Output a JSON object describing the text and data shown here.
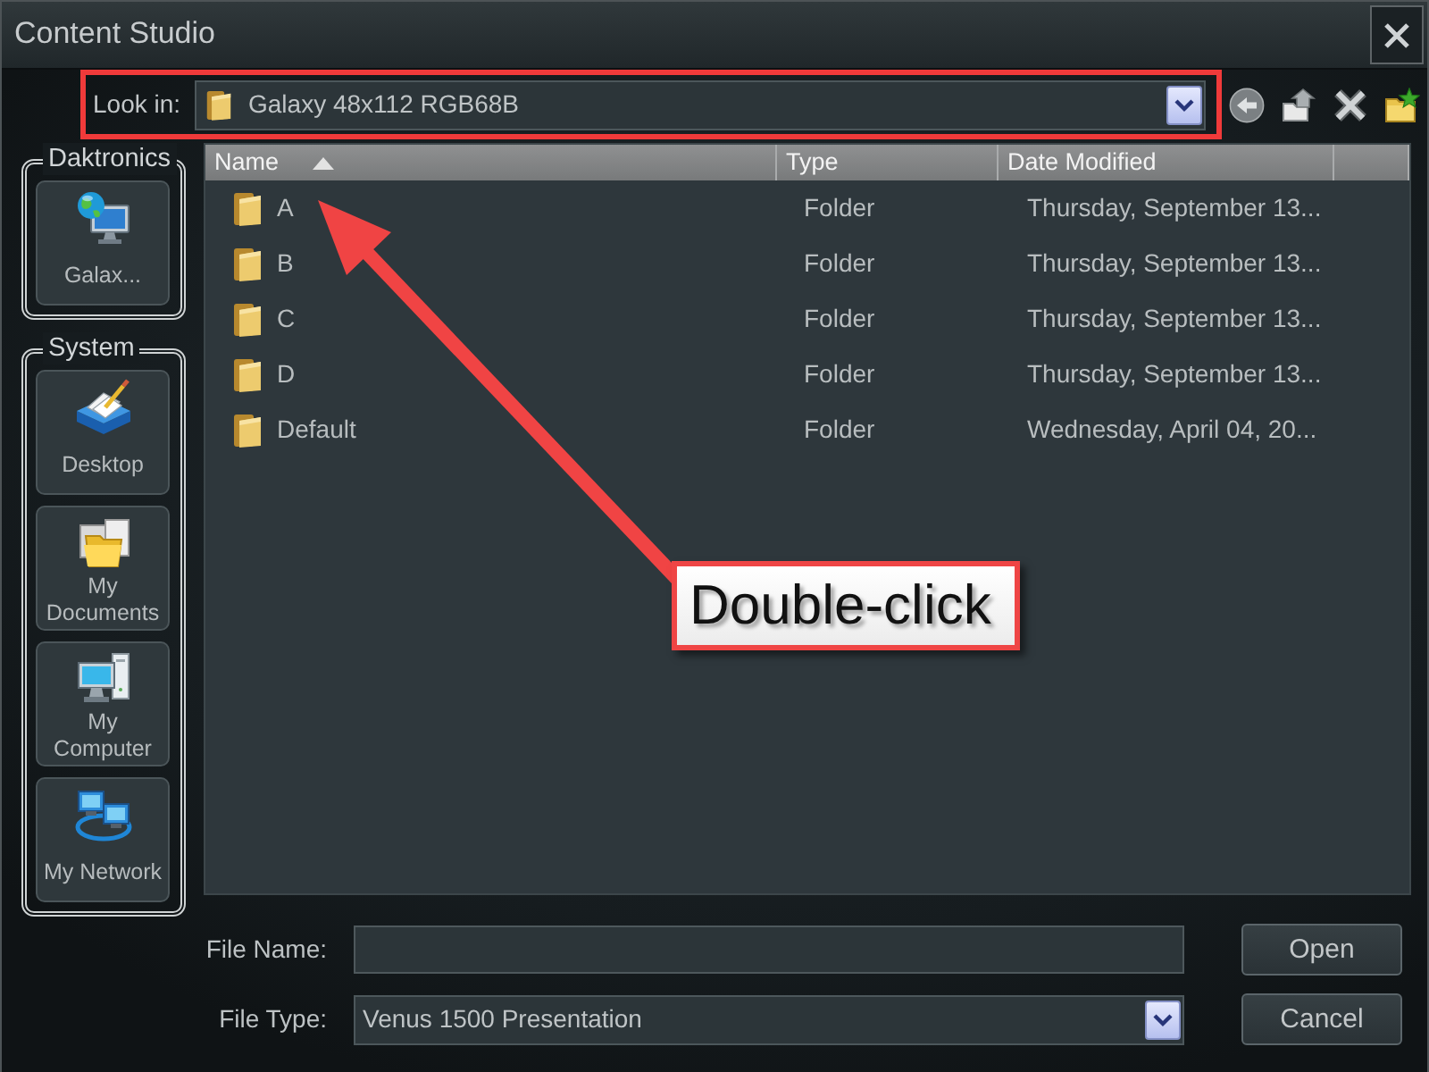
{
  "window": {
    "title": "Content Studio"
  },
  "look_in": {
    "label": "Look in:",
    "value": "Galaxy 48x112 RGB68B",
    "highlighted": true
  },
  "toolbar": [
    {
      "kind": "back"
    },
    {
      "kind": "up"
    },
    {
      "kind": "delete"
    },
    {
      "kind": "new_folder"
    }
  ],
  "places": [
    {
      "title": "Daktronics",
      "items": [
        {
          "kind": "display",
          "label": "Galax..."
        }
      ]
    },
    {
      "title": "System",
      "items": [
        {
          "kind": "desktop",
          "label": "Desktop"
        },
        {
          "kind": "documents",
          "label": "My Documents"
        },
        {
          "kind": "computer",
          "label": "My Computer"
        },
        {
          "kind": "network",
          "label": "My Network"
        }
      ]
    }
  ],
  "file_list": {
    "columns": [
      {
        "label": "Name",
        "sorted": true
      },
      {
        "label": "Type",
        "sorted": false
      },
      {
        "label": "Date Modified",
        "sorted": false
      }
    ],
    "rows": [
      {
        "name": "A",
        "type": "Folder",
        "date_modified": "Thursday, September 13..."
      },
      {
        "name": "B",
        "type": "Folder",
        "date_modified": "Thursday, September 13..."
      },
      {
        "name": "C",
        "type": "Folder",
        "date_modified": "Thursday, September 13..."
      },
      {
        "name": "D",
        "type": "Folder",
        "date_modified": "Thursday, September 13..."
      },
      {
        "name": "Default",
        "type": "Folder",
        "date_modified": "Wednesday, April 04, 20..."
      }
    ]
  },
  "file_name": {
    "label": "File Name:"
  },
  "file_type": {
    "label": "File Type:",
    "value": "Venus 1500 Presentation"
  },
  "buttons": [
    {
      "label": "Open"
    },
    {
      "label": "Cancel"
    }
  ],
  "annotation": {
    "callout": "Double-click"
  }
}
